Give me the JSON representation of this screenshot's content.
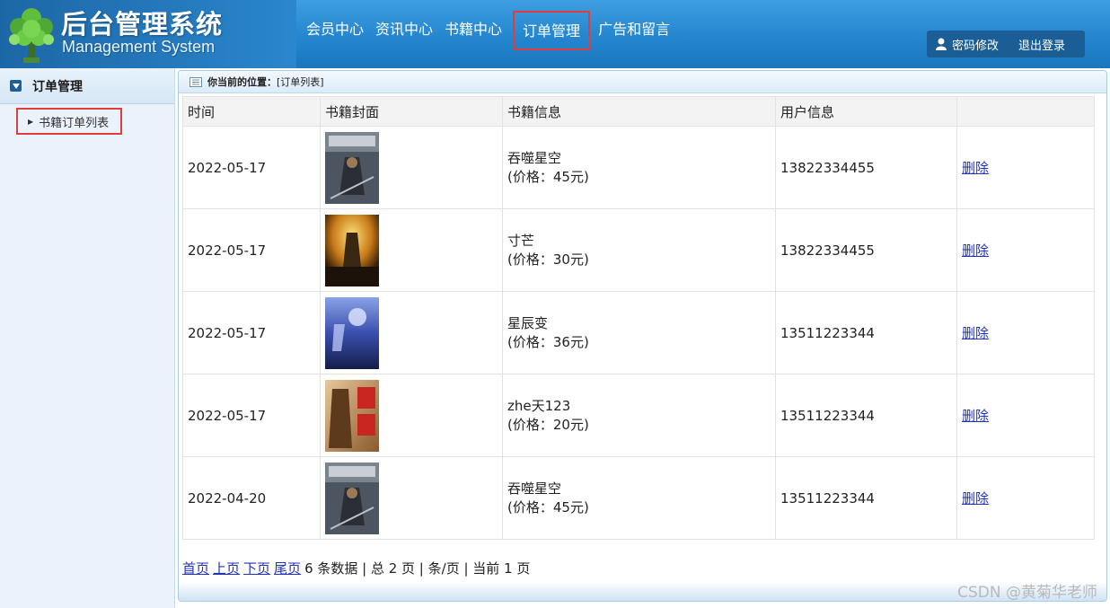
{
  "header": {
    "title": "后台管理系统",
    "subtitle": "Management System",
    "nav": [
      "会员中心",
      "资讯中心",
      "书籍中心",
      "订单管理",
      "广告和留言"
    ],
    "active_nav": "订单管理",
    "user_actions": {
      "change_password": "密码修改",
      "logout": "退出登录"
    }
  },
  "sidebar": {
    "section_title": "订单管理",
    "items": [
      {
        "label": "书籍订单列表"
      }
    ]
  },
  "breadcrumb": {
    "label": "你当前的位置：",
    "path": "[订单列表]"
  },
  "table": {
    "columns": [
      "时间",
      "书籍封面",
      "书籍信息",
      "用户信息",
      ""
    ],
    "rows": [
      {
        "time": "2022-05-17",
        "cover": "tunshi-xingkong-cover",
        "title": "吞噬星空",
        "price": "(价格：45元)",
        "user": "13822334455",
        "action": "删除"
      },
      {
        "time": "2022-05-17",
        "cover": "cunmang-cover",
        "title": "寸芒",
        "price": "(价格：30元)",
        "user": "13822334455",
        "action": "删除"
      },
      {
        "time": "2022-05-17",
        "cover": "xingchenbian-cover",
        "title": "星辰变",
        "price": "(价格：36元)",
        "user": "13511223344",
        "action": "删除"
      },
      {
        "time": "2022-05-17",
        "cover": "zhetian-cover",
        "title": "zhe天123",
        "price": "(价格：20元)",
        "user": "13511223344",
        "action": "删除"
      },
      {
        "time": "2022-04-20",
        "cover": "tunshi-xingkong-cover",
        "title": "吞噬星空",
        "price": "(价格：45元)",
        "user": "13511223344",
        "action": "删除"
      }
    ]
  },
  "pager": {
    "first": "首页",
    "prev": "上页",
    "next": "下页",
    "last": "尾页",
    "summary": "6 条数据 | 总 2 页 | 条/页 | 当前 1 页"
  },
  "watermark": "CSDN @黄菊华老师",
  "colors": {
    "header_blue": "#2486cf",
    "highlight_red": "#e03d3d",
    "link_blue": "#2233bb"
  }
}
